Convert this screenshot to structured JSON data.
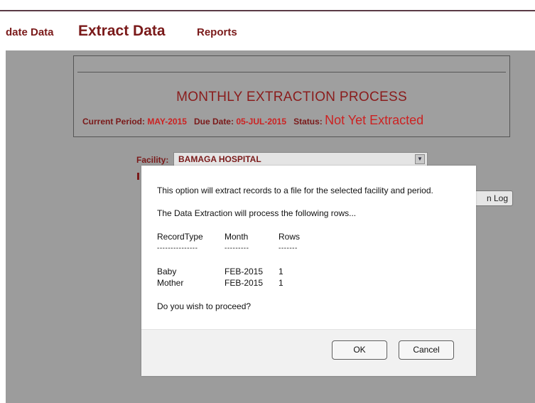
{
  "nav": {
    "update_label": "date Data",
    "extract_label": "Extract Data",
    "reports_label": "Reports"
  },
  "period": {
    "title": "MONTHLY EXTRACTION PROCESS",
    "current_period_label": "Current Period:",
    "current_period_value": "MAY-2015",
    "due_date_label": "Due Date:",
    "due_date_value": "05-JUL-2015",
    "status_label": "Status:",
    "status_value": "Not Yet Extracted"
  },
  "facility": {
    "label": "Facility:",
    "selected": "BAMAGA HOSPITAL"
  },
  "log_button": "n Log",
  "dialog": {
    "message": "This option will extract records to a file for the selected facility and period.",
    "intro": "The Data Extraction will process the following rows...",
    "headers": [
      "RecordType",
      "Month",
      "Rows"
    ],
    "dashes": [
      "---------------",
      "---------",
      "-------"
    ],
    "rows": [
      [
        "Baby",
        "FEB-2015",
        "1"
      ],
      [
        "Mother",
        "FEB-2015",
        "1"
      ]
    ],
    "question": "Do you wish to proceed?",
    "ok_label": "OK",
    "cancel_label": "Cancel"
  },
  "colors": {
    "nav_text": "#7a1a1a",
    "highlight_red": "#cc2222",
    "panel_gray": "#9c9c9c"
  }
}
